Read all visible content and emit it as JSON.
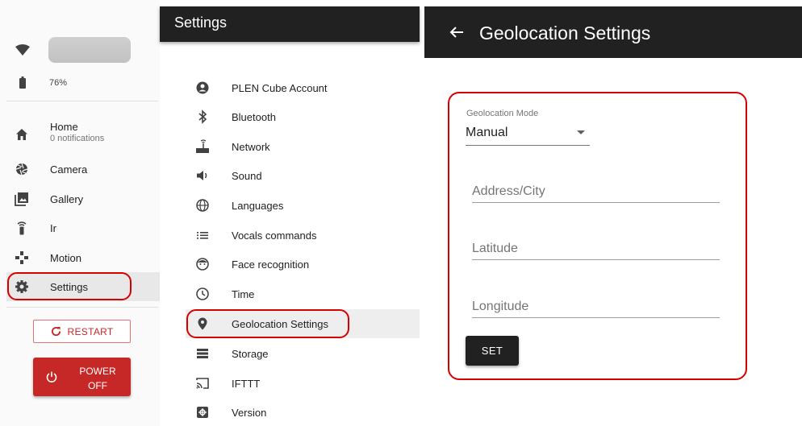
{
  "status": {
    "battery": "76%"
  },
  "nav": {
    "home": {
      "label": "Home",
      "sub": "0 notifications"
    },
    "items": [
      {
        "label": "Camera",
        "icon": "camera-iris-icon"
      },
      {
        "label": "Gallery",
        "icon": "gallery-icon"
      },
      {
        "label": "Ir",
        "icon": "remote-icon"
      },
      {
        "label": "Motion",
        "icon": "gamepad-icon"
      },
      {
        "label": "Settings",
        "icon": "gear-icon"
      }
    ],
    "restart": "RESTART",
    "power_line1": "POWER",
    "power_line2": "OFF"
  },
  "settings": {
    "title": "Settings",
    "items": [
      {
        "label": "PLEN Cube Account",
        "icon": "account-circle-icon"
      },
      {
        "label": "Bluetooth",
        "icon": "bluetooth-icon"
      },
      {
        "label": "Network",
        "icon": "router-icon"
      },
      {
        "label": "Sound",
        "icon": "speaker-icon"
      },
      {
        "label": "Languages",
        "icon": "globe-icon"
      },
      {
        "label": "Vocals commands",
        "icon": "list-icon"
      },
      {
        "label": "Face recognition",
        "icon": "face-icon"
      },
      {
        "label": "Time",
        "icon": "clock-icon"
      },
      {
        "label": "Geolocation Settings",
        "icon": "location-pin-icon"
      },
      {
        "label": "Storage",
        "icon": "storage-icon"
      },
      {
        "label": "IFTTT",
        "icon": "cast-icon"
      },
      {
        "label": "Version",
        "icon": "version-icon"
      }
    ]
  },
  "geo": {
    "title": "Geolocation Settings",
    "mode_label": "Geolocation Mode",
    "mode_value": "Manual",
    "address_placeholder": "Address/City",
    "latitude_placeholder": "Latitude",
    "longitude_placeholder": "Longitude",
    "set_label": "SET"
  },
  "colors": {
    "accent_red": "#d50000",
    "header_dark": "#212121",
    "power_red": "#c62828"
  }
}
